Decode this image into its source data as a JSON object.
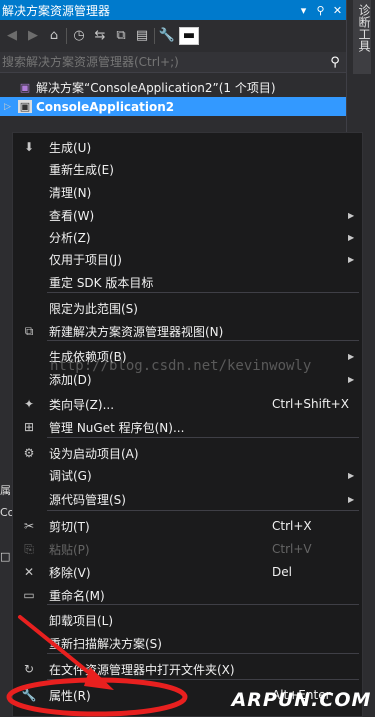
{
  "window": {
    "title": "解决方案资源管理器",
    "pin_symbol": "▾",
    "pin2_symbol": "ᵩ",
    "close_symbol": "✕",
    "side_tab": "诊断工具"
  },
  "search": {
    "placeholder": "搜索解决方案资源管理器(Ctrl+;)"
  },
  "tree": {
    "solution_label": "解决方案“ConsoleApplication2”(1 个项目)",
    "project_label": "ConsoleApplication2"
  },
  "left_stub": [
    "属",
    "Co",
    "",
    "□"
  ],
  "context_menu": {
    "items": [
      {
        "label": "生成(U)",
        "icon": "build-icon",
        "glyph": "⬇",
        "shortcut": "",
        "submenu": false
      },
      {
        "label": "重新生成(E)",
        "shortcut": "",
        "submenu": false
      },
      {
        "label": "清理(N)",
        "shortcut": "",
        "submenu": false
      },
      {
        "label": "查看(W)",
        "shortcut": "",
        "submenu": true
      },
      {
        "label": "分析(Z)",
        "shortcut": "",
        "submenu": true
      },
      {
        "label": "仅用于项目(J)",
        "shortcut": "",
        "submenu": true
      },
      {
        "label": "重定 SDK 版本目标",
        "shortcut": "",
        "submenu": false
      },
      {
        "label": "限定为此范围(S)",
        "shortcut": "",
        "submenu": false
      },
      {
        "label": "新建解决方案资源管理器视图(N)",
        "icon": "new-view-icon",
        "glyph": "⧉",
        "shortcut": "",
        "submenu": false
      },
      {
        "label": "生成依赖项(B)",
        "shortcut": "",
        "submenu": true
      },
      {
        "label": "添加(D)",
        "shortcut": "",
        "submenu": true
      },
      {
        "label": "类向导(Z)...",
        "icon": "class-wizard-icon",
        "glyph": "✦",
        "shortcut": "Ctrl+Shift+X",
        "submenu": false
      },
      {
        "label": "管理 NuGet 程序包(N)...",
        "icon": "nuget-icon",
        "glyph": "⊞",
        "shortcut": "",
        "submenu": false
      },
      {
        "label": "设为启动项目(A)",
        "icon": "gear-icon",
        "glyph": "⚙",
        "shortcut": "",
        "submenu": false
      },
      {
        "label": "调试(G)",
        "shortcut": "",
        "submenu": true
      },
      {
        "label": "源代码管理(S)",
        "shortcut": "",
        "submenu": true
      },
      {
        "label": "剪切(T)",
        "icon": "cut-icon",
        "glyph": "✂",
        "shortcut": "Ctrl+X",
        "submenu": false
      },
      {
        "label": "粘贴(P)",
        "icon": "paste-icon",
        "glyph": "⎘",
        "shortcut": "Ctrl+V",
        "submenu": false,
        "disabled": true
      },
      {
        "label": "移除(V)",
        "icon": "remove-icon",
        "glyph": "✕",
        "shortcut": "Del",
        "submenu": false
      },
      {
        "label": "重命名(M)",
        "icon": "rename-icon",
        "glyph": "▭",
        "shortcut": "",
        "submenu": false
      },
      {
        "label": "卸载项目(L)",
        "shortcut": "",
        "submenu": false
      },
      {
        "label": "重新扫描解决方案(S)",
        "shortcut": "",
        "submenu": false
      },
      {
        "label": "在文件资源管理器中打开文件夹(X)",
        "icon": "refresh-icon",
        "glyph": "↻",
        "shortcut": "",
        "submenu": false
      },
      {
        "label": "属性(R)",
        "icon": "properties-icon",
        "glyph": "🔧",
        "shortcut": "Alt+Enter",
        "submenu": false
      }
    ],
    "arrow_glyph": "▶"
  },
  "watermark": "http://blog.csdn.net/kevinwowly",
  "logo": "ARPUN.COM",
  "colors": {
    "accent": "#007acc",
    "selected": "#3399ff",
    "annotation": "#e8201f"
  }
}
